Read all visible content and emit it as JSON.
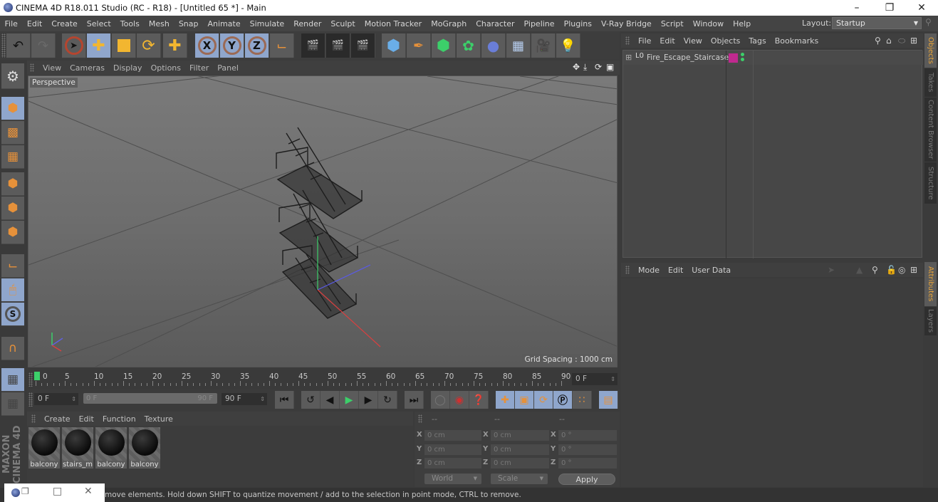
{
  "window": {
    "title": "CINEMA 4D R18.011 Studio (RC - R18) - [Untitled 65 *] - Main",
    "controls": [
      "minimize",
      "restore",
      "close"
    ]
  },
  "menubar": {
    "items": [
      "File",
      "Edit",
      "Create",
      "Select",
      "Tools",
      "Mesh",
      "Snap",
      "Animate",
      "Simulate",
      "Render",
      "Sculpt",
      "Motion Tracker",
      "MoGraph",
      "Character",
      "Pipeline",
      "Plugins",
      "V-Ray Bridge",
      "Script",
      "Window",
      "Help"
    ],
    "layout_label": "Layout:",
    "layout_value": "Startup"
  },
  "toolbar": {
    "groups": [
      [
        "undo-icon",
        "redo-icon"
      ],
      [
        "live-selection-icon",
        "move-icon",
        "scale-icon",
        "rotate-icon",
        "recent-tools-icon"
      ],
      [
        "x-axis-lock-icon",
        "y-axis-lock-icon",
        "z-axis-lock-icon",
        "coordinate-system-icon"
      ],
      [
        "render-region-icon",
        "render-to-picture-viewer-icon",
        "render-settings-icon"
      ],
      [
        "cube-icon",
        "pen-spline-icon",
        "subdivision-surface-icon",
        "cloner-icon",
        "bend-deformer-icon",
        "floor-icon",
        "camera-icon",
        "light-icon"
      ]
    ],
    "axis_labels": {
      "x": "X",
      "y": "Y",
      "z": "Z"
    }
  },
  "viewport": {
    "menu": [
      "View",
      "Cameras",
      "Display",
      "Options",
      "Filter",
      "Panel"
    ],
    "camera_label": "Perspective",
    "grid_spacing": "Grid Spacing : 1000 cm",
    "nav_icons": [
      "move-view-icon",
      "dolly-view-icon",
      "rotate-view-icon",
      "toggle-layout-icon"
    ]
  },
  "left_palette": {
    "items": [
      "model-mode",
      "texture-mode",
      "workplane-mode",
      "points-mode",
      "edges-mode",
      "polygons-mode",
      "axis-mode",
      "tweak-mode",
      "snap-mode",
      "magnet-tool",
      "lock-workplane",
      "planar-workplane"
    ]
  },
  "timeline": {
    "ticks": [
      "0",
      "5",
      "10",
      "15",
      "20",
      "25",
      "30",
      "35",
      "40",
      "45",
      "50",
      "55",
      "60",
      "65",
      "70",
      "75",
      "80",
      "85",
      "90"
    ],
    "current_frame": "0 F",
    "start_field": "0 F",
    "range_start": "0 F",
    "range_end": "90 F",
    "end_field": "90 F"
  },
  "transport": {
    "buttons": [
      "go-to-start",
      "previous-key",
      "previous-frame",
      "play",
      "next-frame",
      "next-key",
      "go-to-end",
      "record-active",
      "autokeying",
      "keyframe-selection",
      "key-position",
      "key-scale",
      "key-rotation",
      "key-parameter",
      "key-point-level",
      "timeline-layout"
    ]
  },
  "materials": {
    "menu": [
      "Create",
      "Edit",
      "Function",
      "Texture"
    ],
    "items": [
      "balcony",
      "stairs_m",
      "balcony",
      "balcony"
    ]
  },
  "coordinates": {
    "headers": [
      "--",
      "--",
      "--"
    ],
    "rows": [
      {
        "axis": "X",
        "pos": "0 cm",
        "size": "0 cm",
        "rot": "0 °"
      },
      {
        "axis": "Y",
        "pos": "0 cm",
        "size": "0 cm",
        "rot": "0 °"
      },
      {
        "axis": "Z",
        "pos": "0 cm",
        "size": "0 cm",
        "rot": "0 °"
      }
    ],
    "space": "World",
    "mode": "Scale",
    "apply_label": "Apply"
  },
  "object_manager": {
    "menu": [
      "File",
      "Edit",
      "View",
      "Objects",
      "Tags",
      "Bookmarks"
    ],
    "objects": [
      {
        "name": "Fire_Escape_Staircase",
        "layer_badge": "L0",
        "color_tag": "#c0298f",
        "visibility_dots": [
          "#3ccf6a",
          "#3ccf6a"
        ]
      }
    ]
  },
  "attribute_manager": {
    "menu": [
      "Mode",
      "Edit",
      "User Data"
    ]
  },
  "side_tabs": {
    "top": [
      {
        "label": "Objects",
        "active": true
      },
      {
        "label": "Takes",
        "active": false
      },
      {
        "label": "Content Browser",
        "active": false
      },
      {
        "label": "Structure",
        "active": false
      }
    ],
    "bottom": [
      {
        "label": "Attributes",
        "active": true
      },
      {
        "label": "Layers",
        "active": false
      }
    ]
  },
  "status_bar": {
    "text": "move elements. Hold down SHIFT to quantize movement / add to the selection in point mode, CTRL to remove."
  },
  "branding": {
    "logo": "MAXON CINEMA 4D"
  },
  "colors": {
    "accent_blue": "#8fa6cc",
    "accent_orange": "#e6913a",
    "active_tab": "#e6a43a",
    "timeline_marker": "#3ccf6a"
  }
}
